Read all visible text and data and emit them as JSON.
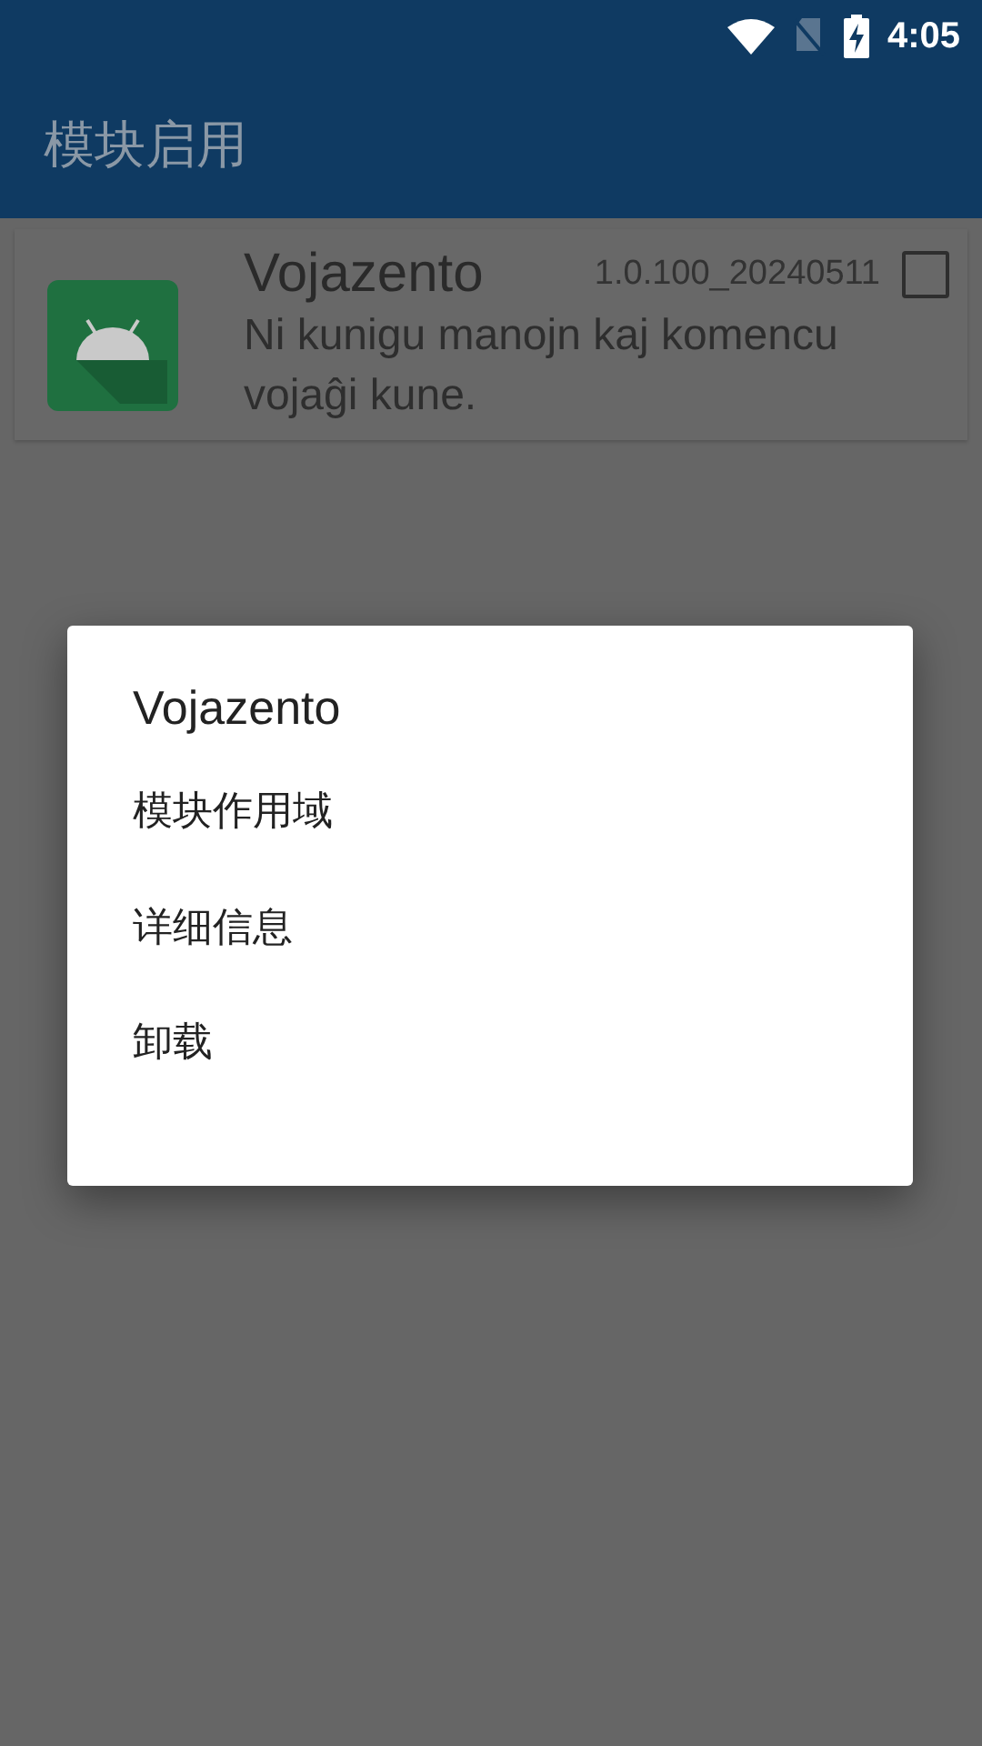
{
  "status_bar": {
    "time": "4:05"
  },
  "app_bar": {
    "title": "模块启用"
  },
  "modules": [
    {
      "name": "Vojazento",
      "version": "1.0.100_20240511",
      "description": "Ni kunigu manojn kaj komencu vojaĝi kune.",
      "checked": false
    }
  ],
  "dialog": {
    "title": "Vojazento",
    "items": [
      "模块作用域",
      "详细信息",
      "卸载"
    ]
  }
}
